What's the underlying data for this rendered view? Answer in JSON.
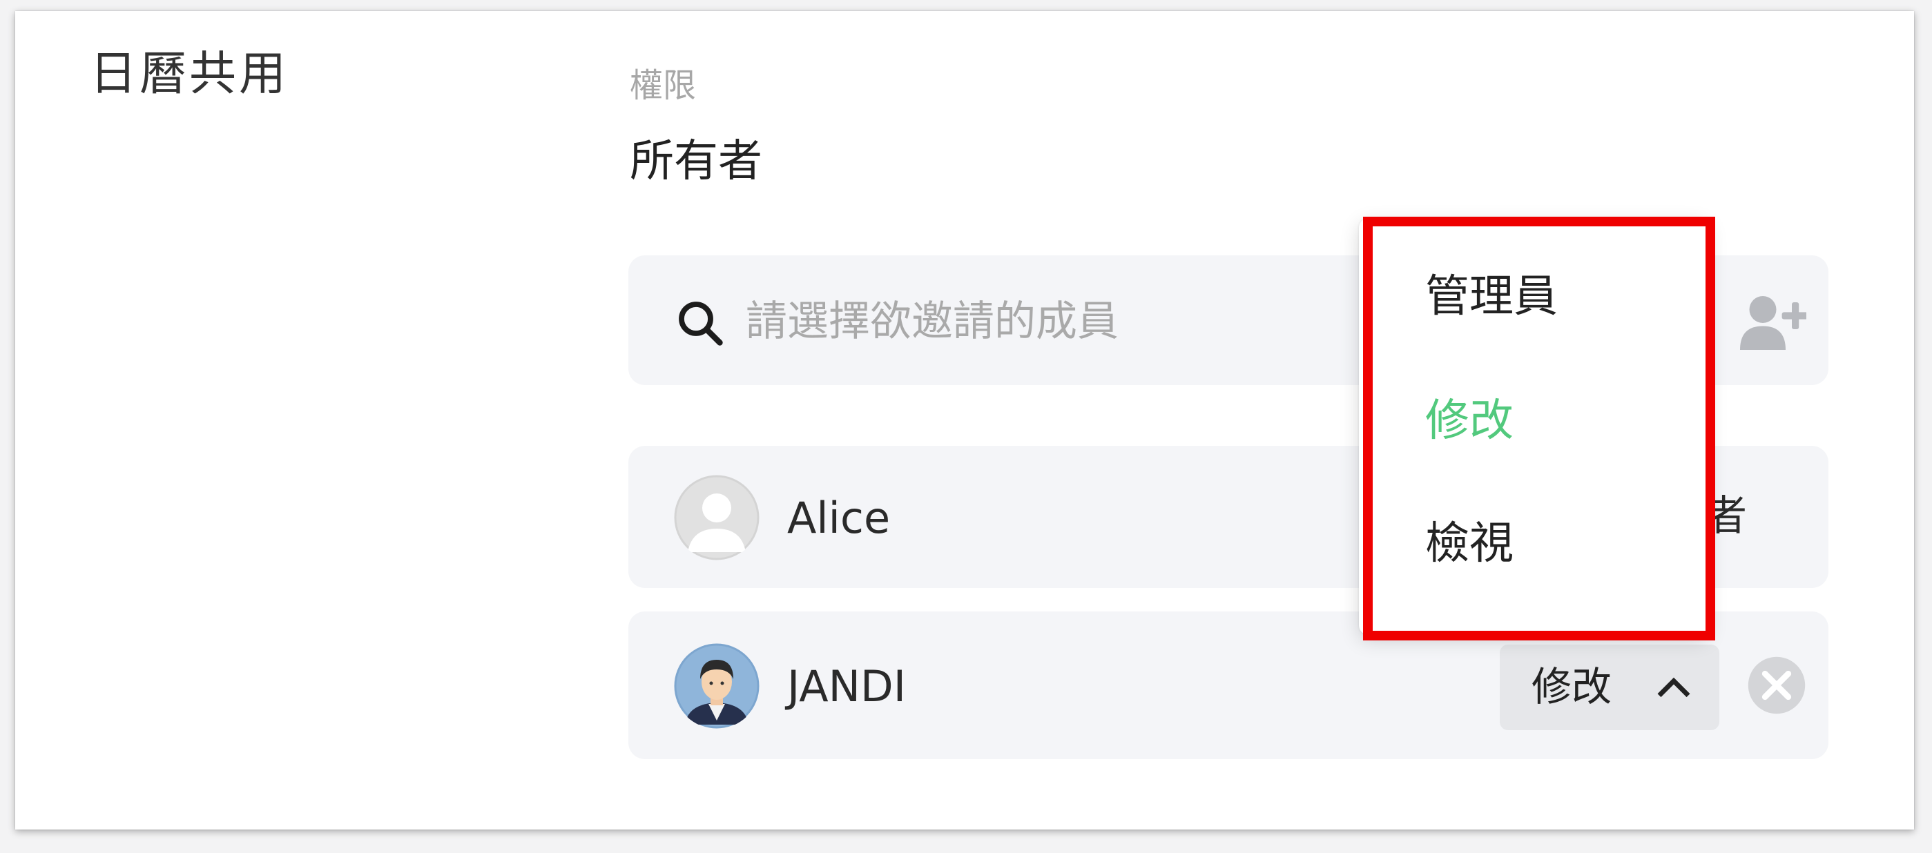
{
  "section": {
    "title": "日曆共用"
  },
  "permission": {
    "caption": "權限",
    "value": "所有者"
  },
  "search": {
    "placeholder": "請選擇欲邀請的成員",
    "icon": "search-icon",
    "add_icon": "add-user-icon"
  },
  "members": [
    {
      "name": "Alice",
      "role": "者",
      "avatar": "default-avatar"
    },
    {
      "name": "JANDI",
      "role": "修改",
      "avatar": "jandi-avatar",
      "dropdown_icon": "chevron-up-icon",
      "remove_icon": "close-circle-icon"
    }
  ],
  "role_menu": {
    "items": [
      "管理員",
      "修改",
      "檢視"
    ],
    "selected": "修改",
    "selected_color": "#52c97d"
  },
  "colors": {
    "highlight": "#ef0000",
    "row_background": "#f4f5f8"
  }
}
